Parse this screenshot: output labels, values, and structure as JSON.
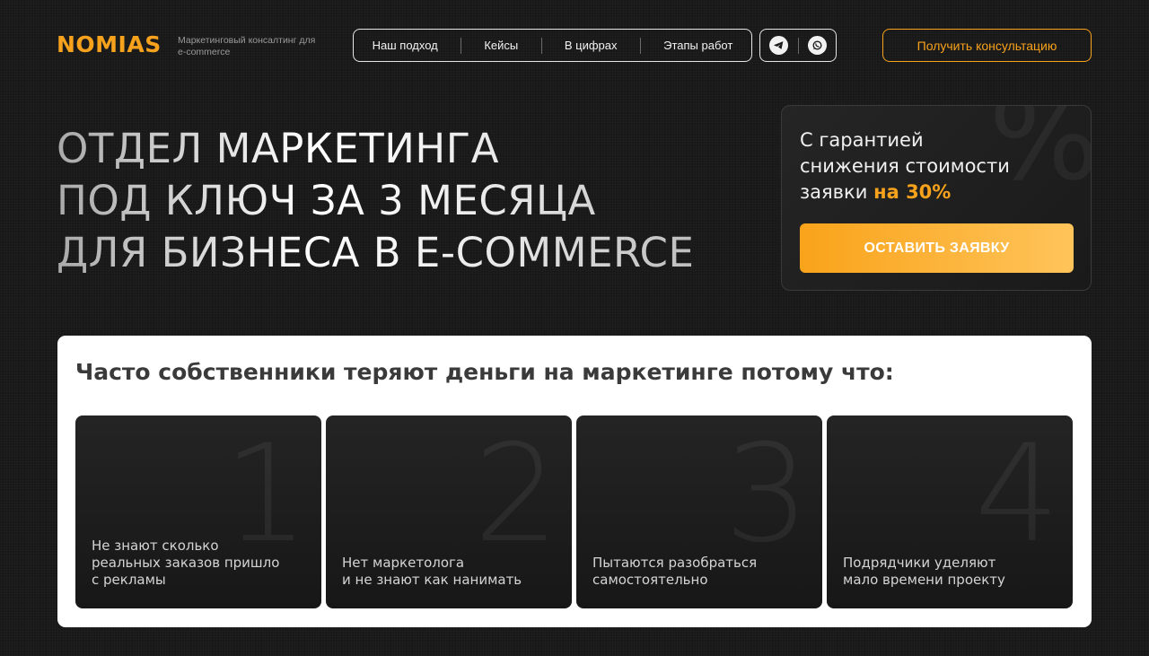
{
  "header": {
    "logo": "NOMIAS",
    "tagline": "Маркетинговый консалтинг для e-commerce",
    "nav": [
      "Наш подход",
      "Кейсы",
      "В цифрах",
      "Этапы работ"
    ],
    "consult_label": "Получить консультацию"
  },
  "hero": {
    "title_lines": [
      "ОТДЕЛ МАРКЕТИНГА",
      "ПОД КЛЮЧ ЗА 3 МЕСЯЦА",
      "ДЛЯ БИЗНЕСА В E-COMMERCE"
    ]
  },
  "offer": {
    "deco": "%",
    "line1": "С гарантией",
    "line2": "снижения стоимости",
    "line3": "заявки",
    "accent": "на 30%",
    "button_label": "ОСТАВИТЬ ЗАЯВКУ"
  },
  "problems": {
    "title": "Часто собственники теряют деньги на маркетинге потому что:",
    "cards": [
      {
        "num": "1",
        "text": "Не знают сколько\nреальных заказов пришло\nс рекламы"
      },
      {
        "num": "2",
        "text": "Нет маркетолога\nи не знают как нанимать"
      },
      {
        "num": "3",
        "text": "Пытаются разобраться\nсамостоятельно"
      },
      {
        "num": "4",
        "text": "Подрядчики уделяют\nмало времени проекту"
      }
    ]
  },
  "colors": {
    "accent": "#f7a21c",
    "background": "#181818"
  },
  "icons": [
    "telegram-icon",
    "whatsapp-icon"
  ]
}
